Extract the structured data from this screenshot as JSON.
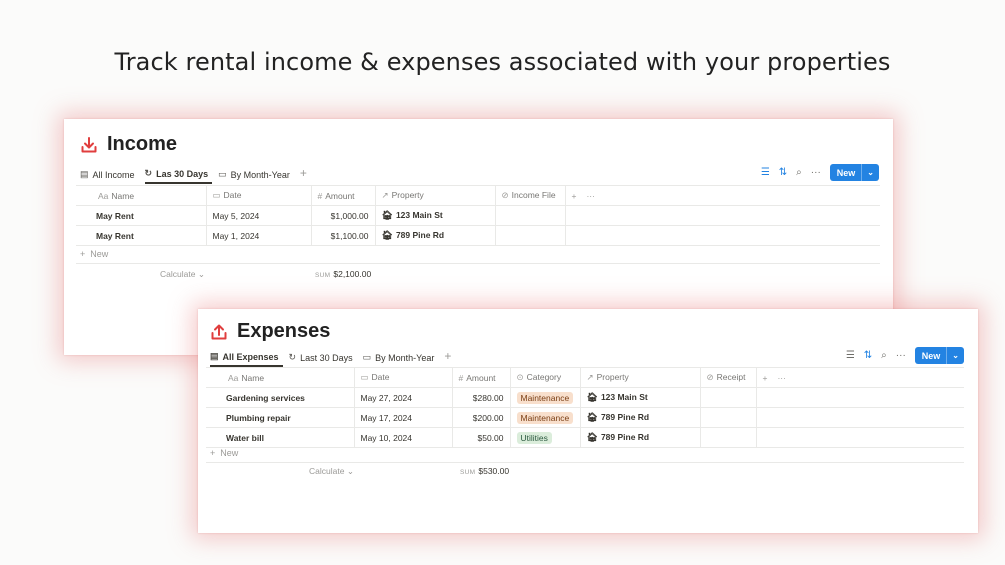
{
  "headline": "Track rental income & expenses associated with your properties",
  "colors": {
    "accent_red": "#e03e3e",
    "button_blue": "#2383e2",
    "maintenance_tag": "#f8dfcc",
    "utilities_tag": "#dbeddb"
  },
  "toolbar": {
    "new_label": "New",
    "icons": [
      "filter-icon",
      "sort-icon",
      "search-icon",
      "more-icon"
    ]
  },
  "income": {
    "title": "Income",
    "icon": "download-icon",
    "views": [
      {
        "label": "All Income",
        "icon": "table-icon",
        "active": false
      },
      {
        "label": "Las 30 Days",
        "icon": "rotate-icon",
        "active": true
      },
      {
        "label": "By Month-Year",
        "icon": "calendar-icon",
        "active": false
      }
    ],
    "columns": {
      "name": "Name",
      "date": "Date",
      "amount": "Amount",
      "property": "Property",
      "file": "Income File"
    },
    "rows": [
      {
        "name": "May Rent",
        "date": "May 5, 2024",
        "amount": "$1,000.00",
        "property": "123 Main St"
      },
      {
        "name": "May Rent",
        "date": "May 1, 2024",
        "amount": "$1,100.00",
        "property": "789 Pine Rd"
      }
    ],
    "new_row": "New",
    "calculate": "Calculate",
    "sum_label": "SUM",
    "sum_value": "$2,100.00"
  },
  "expenses": {
    "title": "Expenses",
    "icon": "upload-icon",
    "views": [
      {
        "label": "All Expenses",
        "icon": "table-icon",
        "active": true
      },
      {
        "label": "Last 30 Days",
        "icon": "rotate-icon",
        "active": false
      },
      {
        "label": "By Month-Year",
        "icon": "calendar-icon",
        "active": false
      }
    ],
    "columns": {
      "name": "Name",
      "date": "Date",
      "amount": "Amount",
      "category": "Category",
      "property": "Property",
      "receipt": "Receipt"
    },
    "rows": [
      {
        "name": "Gardening services",
        "date": "May 27, 2024",
        "amount": "$280.00",
        "category": "Maintenance",
        "property": "123 Main St"
      },
      {
        "name": "Plumbing repair",
        "date": "May 17, 2024",
        "amount": "$200.00",
        "category": "Maintenance",
        "property": "789 Pine Rd"
      },
      {
        "name": "Water bill",
        "date": "May 10, 2024",
        "amount": "$50.00",
        "category": "Utilities",
        "property": "789 Pine Rd"
      }
    ],
    "new_row": "New",
    "calculate": "Calculate",
    "sum_label": "SUM",
    "sum_value": "$530.00"
  }
}
